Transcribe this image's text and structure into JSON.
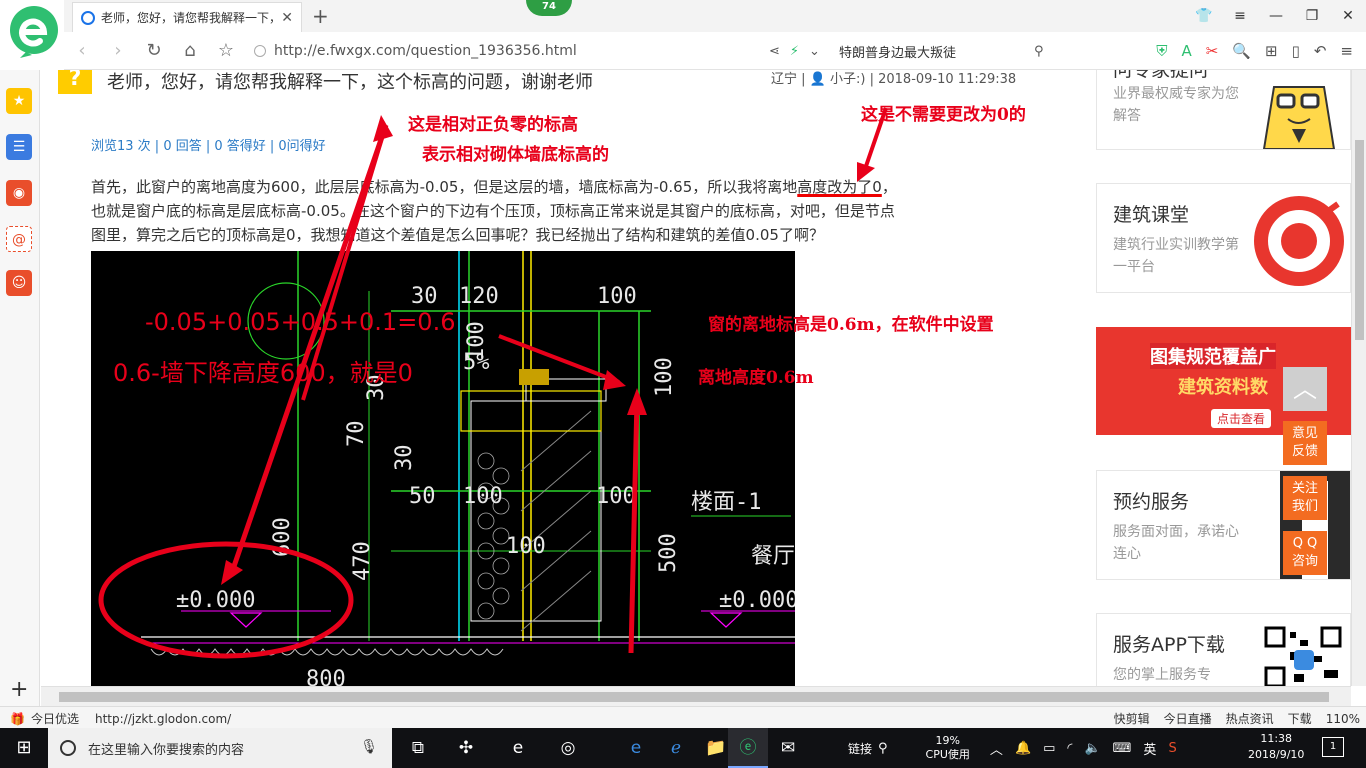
{
  "browser": {
    "tab_title": "老师，您好，请您帮我解释一下，",
    "update_badge": "74",
    "url": "http://e.fwxgx.com/question_1936356.html",
    "search_hint": "特朗普身边最大叛徒",
    "zoom": "110%",
    "status_url": "http://jzkt.glodon.com/",
    "status_left_label": "今日优选",
    "status_items": [
      "快剪辑",
      "今日直播",
      "热点资讯",
      "下载"
    ]
  },
  "question": {
    "title": "老师，您好，请您帮我解释一下，这个标高的问题，谢谢老师",
    "location": "辽宁",
    "user": "小子:)",
    "datetime": "2018-09-10 11:29:38",
    "stats": "浏览13 次 | 0 回答 | 0 答得好 | 0问得好",
    "body_line1_pre": "首先，此窗户的离地高度为600，此层层底标高为-0.05，但是这层的墙，墙底标高为-0.65，所以我将离地",
    "body_line1_ul": "高度改为了0",
    "body_line1_post": "，",
    "body_line2": "也就是窗户底的标高是层底标高-0.05。在这个窗户的下边有个压顶，顶标高正常来说是其窗户的底标高，对吧，但是节点",
    "body_line3": "图里，算完之后它的顶标高是0，我想知道这个差值是怎么回事呢？我已经抛出了结构和建筑的差值0.05了啊？"
  },
  "annotations": {
    "a1_line1": "这是相对正负零的标高",
    "a1_line2": "表示相对砌体墙底标高的",
    "a2": "这是不需要更改为0的",
    "calc1": "-0.05+0.05+0.5+0.1=0.6",
    "calc2": "0.6-墙下降高度600，就是0",
    "a3": "窗的离地标高是0.6m，在软件中设置",
    "a4": "离地高度0.6m"
  },
  "cad": {
    "dims": [
      "30",
      "120",
      "100",
      "5%",
      "30",
      "100",
      "70",
      "30",
      "50",
      "100",
      "100",
      "楼面-1",
      "600",
      "470",
      "100",
      "500",
      "餐厅",
      "±0.000",
      "±0.000",
      "800"
    ]
  },
  "sidebar_cards": {
    "expert_title": "问专家提问",
    "expert_sub": "业界最权威专家为您解答",
    "course_title": "建筑课堂",
    "course_sub": "建筑行业实训教学第一平台",
    "banner_t1": "图集规范覆盖广",
    "banner_t2": "建筑资料数",
    "banner_t3": "点击查看",
    "service_title": "预约服务",
    "service_sub": "服务面对面，承诺心连心",
    "app_title": "服务APP下载",
    "app_sub": "您的掌上服务专"
  },
  "float_buttons": {
    "feedback": "意见反馈",
    "follow": "关注我们",
    "qq": "Q Q咨询"
  },
  "taskbar": {
    "search_placeholder": "在这里输入你要搜索的内容",
    "link_label": "链接",
    "cpu_percent": "19%",
    "cpu_label": "CPU使用",
    "ime": "英",
    "time": "11:38",
    "date": "2018/9/10",
    "notifications": "1"
  },
  "colors": {
    "annotation_red": "#e8001a",
    "link_blue": "#2b7bc6",
    "float_orange": "#f36c21",
    "cad_bg": "#000000"
  }
}
